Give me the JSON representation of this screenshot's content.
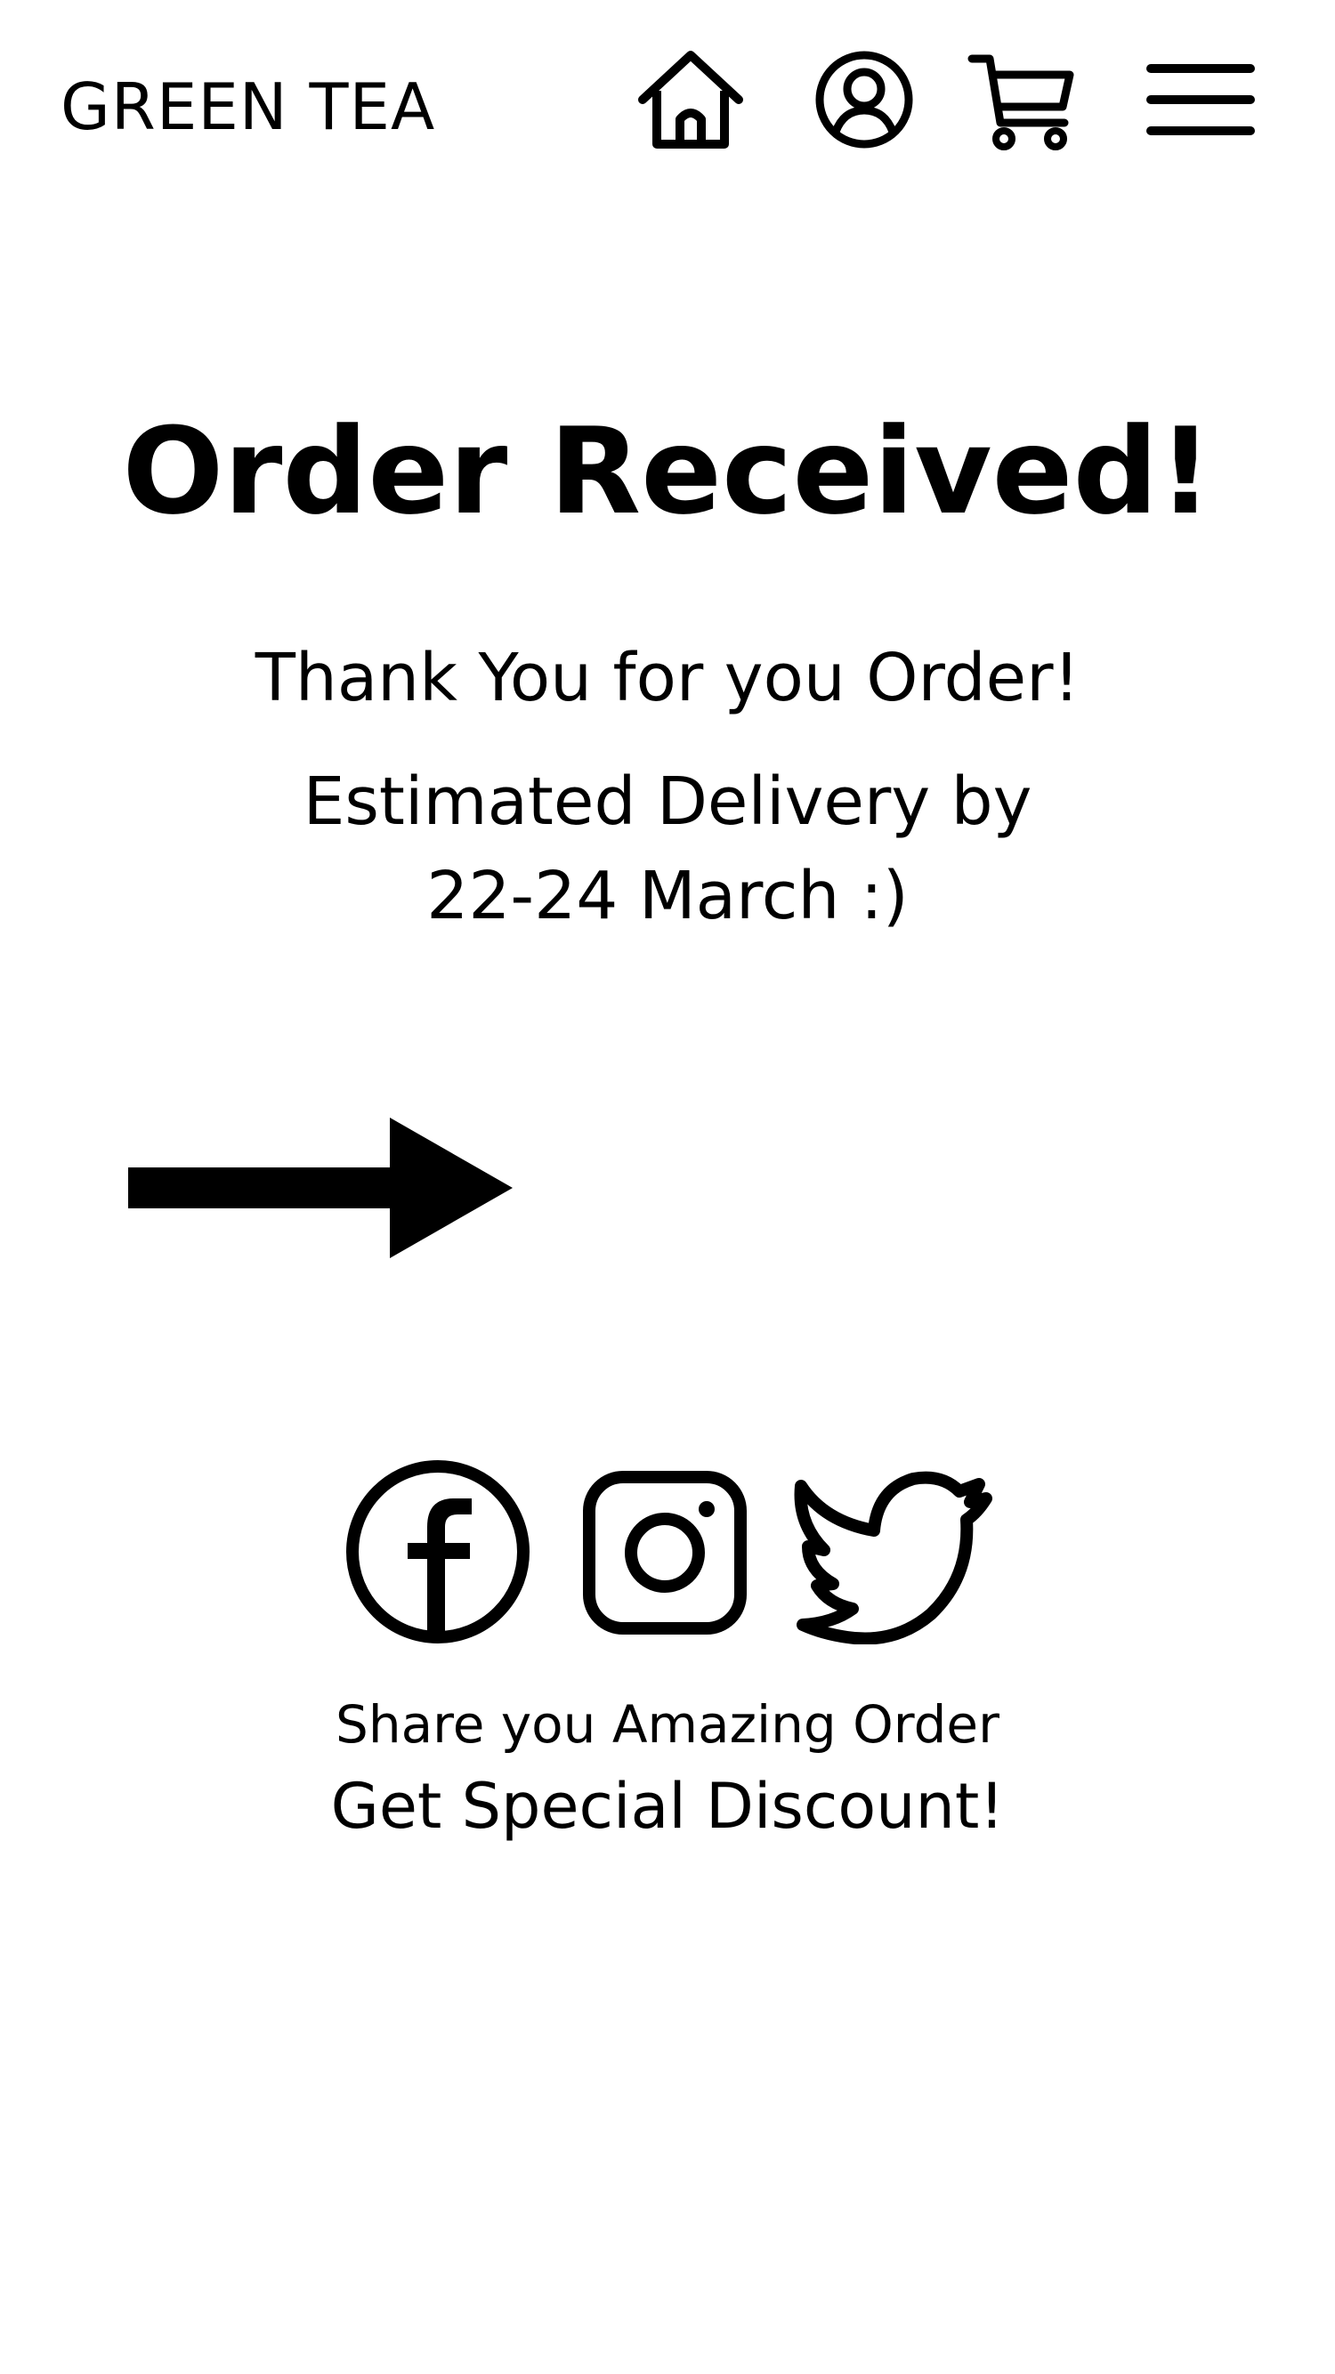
{
  "header": {
    "brand": "GREEN TEA",
    "icons": [
      "home-icon",
      "account-icon",
      "cart-icon",
      "menu-icon"
    ]
  },
  "confirmation": {
    "title": "Order Received!",
    "thanks": "Thank You for you Order!",
    "delivery_line1": "Estimated Delivery by",
    "delivery_line2": "22-24 March :)"
  },
  "continue": {
    "icon": "arrow-right-icon"
  },
  "social": {
    "icons": [
      "facebook-icon",
      "instagram-icon",
      "twitter-icon"
    ],
    "share_text": "Share you Amazing Order",
    "discount_text": "Get Special Discount!"
  },
  "colors": {
    "background": "#ffffff",
    "foreground": "#000000"
  }
}
